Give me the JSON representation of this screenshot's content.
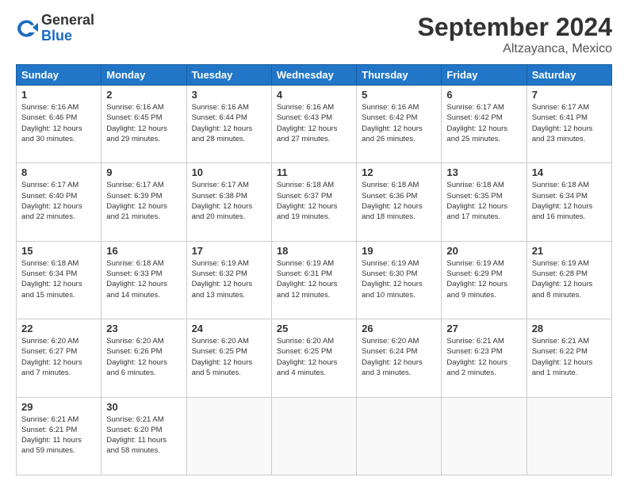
{
  "header": {
    "logo_general": "General",
    "logo_blue": "Blue",
    "month": "September 2024",
    "location": "Altzayanca, Mexico"
  },
  "weekdays": [
    "Sunday",
    "Monday",
    "Tuesday",
    "Wednesday",
    "Thursday",
    "Friday",
    "Saturday"
  ],
  "weeks": [
    [
      {
        "day": "1",
        "detail": "Sunrise: 6:16 AM\nSunset: 6:46 PM\nDaylight: 12 hours and 30 minutes."
      },
      {
        "day": "2",
        "detail": "Sunrise: 6:16 AM\nSunset: 6:45 PM\nDaylight: 12 hours and 29 minutes."
      },
      {
        "day": "3",
        "detail": "Sunrise: 6:16 AM\nSunset: 6:44 PM\nDaylight: 12 hours and 28 minutes."
      },
      {
        "day": "4",
        "detail": "Sunrise: 6:16 AM\nSunset: 6:43 PM\nDaylight: 12 hours and 27 minutes."
      },
      {
        "day": "5",
        "detail": "Sunrise: 6:16 AM\nSunset: 6:42 PM\nDaylight: 12 hours and 26 minutes."
      },
      {
        "day": "6",
        "detail": "Sunrise: 6:17 AM\nSunset: 6:42 PM\nDaylight: 12 hours and 25 minutes."
      },
      {
        "day": "7",
        "detail": "Sunrise: 6:17 AM\nSunset: 6:41 PM\nDaylight: 12 hours and 23 minutes."
      }
    ],
    [
      {
        "day": "8",
        "detail": "Sunrise: 6:17 AM\nSunset: 6:40 PM\nDaylight: 12 hours and 22 minutes."
      },
      {
        "day": "9",
        "detail": "Sunrise: 6:17 AM\nSunset: 6:39 PM\nDaylight: 12 hours and 21 minutes."
      },
      {
        "day": "10",
        "detail": "Sunrise: 6:17 AM\nSunset: 6:38 PM\nDaylight: 12 hours and 20 minutes."
      },
      {
        "day": "11",
        "detail": "Sunrise: 6:18 AM\nSunset: 6:37 PM\nDaylight: 12 hours and 19 minutes."
      },
      {
        "day": "12",
        "detail": "Sunrise: 6:18 AM\nSunset: 6:36 PM\nDaylight: 12 hours and 18 minutes."
      },
      {
        "day": "13",
        "detail": "Sunrise: 6:18 AM\nSunset: 6:35 PM\nDaylight: 12 hours and 17 minutes."
      },
      {
        "day": "14",
        "detail": "Sunrise: 6:18 AM\nSunset: 6:34 PM\nDaylight: 12 hours and 16 minutes."
      }
    ],
    [
      {
        "day": "15",
        "detail": "Sunrise: 6:18 AM\nSunset: 6:34 PM\nDaylight: 12 hours and 15 minutes."
      },
      {
        "day": "16",
        "detail": "Sunrise: 6:18 AM\nSunset: 6:33 PM\nDaylight: 12 hours and 14 minutes."
      },
      {
        "day": "17",
        "detail": "Sunrise: 6:19 AM\nSunset: 6:32 PM\nDaylight: 12 hours and 13 minutes."
      },
      {
        "day": "18",
        "detail": "Sunrise: 6:19 AM\nSunset: 6:31 PM\nDaylight: 12 hours and 12 minutes."
      },
      {
        "day": "19",
        "detail": "Sunrise: 6:19 AM\nSunset: 6:30 PM\nDaylight: 12 hours and 10 minutes."
      },
      {
        "day": "20",
        "detail": "Sunrise: 6:19 AM\nSunset: 6:29 PM\nDaylight: 12 hours and 9 minutes."
      },
      {
        "day": "21",
        "detail": "Sunrise: 6:19 AM\nSunset: 6:28 PM\nDaylight: 12 hours and 8 minutes."
      }
    ],
    [
      {
        "day": "22",
        "detail": "Sunrise: 6:20 AM\nSunset: 6:27 PM\nDaylight: 12 hours and 7 minutes."
      },
      {
        "day": "23",
        "detail": "Sunrise: 6:20 AM\nSunset: 6:26 PM\nDaylight: 12 hours and 6 minutes."
      },
      {
        "day": "24",
        "detail": "Sunrise: 6:20 AM\nSunset: 6:25 PM\nDaylight: 12 hours and 5 minutes."
      },
      {
        "day": "25",
        "detail": "Sunrise: 6:20 AM\nSunset: 6:25 PM\nDaylight: 12 hours and 4 minutes."
      },
      {
        "day": "26",
        "detail": "Sunrise: 6:20 AM\nSunset: 6:24 PM\nDaylight: 12 hours and 3 minutes."
      },
      {
        "day": "27",
        "detail": "Sunrise: 6:21 AM\nSunset: 6:23 PM\nDaylight: 12 hours and 2 minutes."
      },
      {
        "day": "28",
        "detail": "Sunrise: 6:21 AM\nSunset: 6:22 PM\nDaylight: 12 hours and 1 minute."
      }
    ],
    [
      {
        "day": "29",
        "detail": "Sunrise: 6:21 AM\nSunset: 6:21 PM\nDaylight: 11 hours and 59 minutes."
      },
      {
        "day": "30",
        "detail": "Sunrise: 6:21 AM\nSunset: 6:20 PM\nDaylight: 11 hours and 58 minutes."
      },
      null,
      null,
      null,
      null,
      null
    ]
  ]
}
